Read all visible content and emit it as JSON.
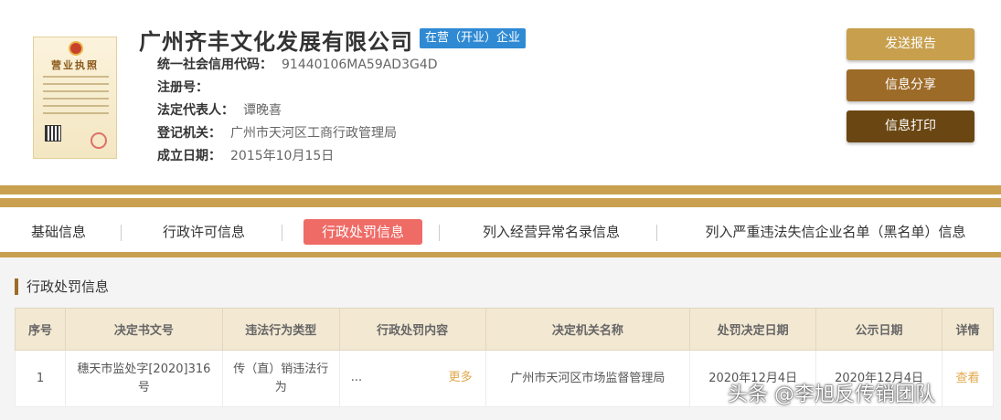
{
  "company": {
    "name": "广州齐丰文化发展有限公司",
    "status": "在营（开业）企业",
    "credit_code_label": "统一社会信用代码：",
    "credit_code": "91440106MA59AD3G4D",
    "reg_no_label": "注册号：",
    "reg_no": "",
    "legal_rep_label": "法定代表人：",
    "legal_rep": "谭晚喜",
    "authority_label": "登记机关：",
    "authority": "广州市天河区工商行政管理局",
    "established_label": "成立日期：",
    "established": "2015年10月15日"
  },
  "license_image": {
    "title": "营业执照"
  },
  "actions": {
    "send_report": "发送报告",
    "share_info": "信息分享",
    "print_info": "信息打印"
  },
  "tabs": [
    {
      "label": "基础信息"
    },
    {
      "label": "行政许可信息"
    },
    {
      "label": "行政处罚信息"
    },
    {
      "label": "列入经营异常名录信息"
    },
    {
      "label": "列入严重违法失信企业名单（黑名单）信息"
    }
  ],
  "section": {
    "title": "行政处罚信息"
  },
  "table": {
    "headers": [
      "序号",
      "决定书文号",
      "违法行为类型",
      "行政处罚内容",
      "决定机关名称",
      "处罚决定日期",
      "公示日期",
      "详情"
    ],
    "rows": [
      {
        "index": "1",
        "doc_no": "穗天市监处字[2020]316号",
        "violation": "传（直）销违法行为",
        "content": "...",
        "more": "更多",
        "authority": "广州市天河区市场监督管理局",
        "decision_date": "2020年12月4日",
        "publish_date": "2020年12月4日",
        "detail": "查看"
      }
    ]
  },
  "watermark": "头条 @李旭反传销团队",
  "colors": {
    "gold": "#c9a04f",
    "status_blue": "#2f8ad3",
    "active_tab": "#ef6b66",
    "link_orange": "#e2a74a"
  }
}
